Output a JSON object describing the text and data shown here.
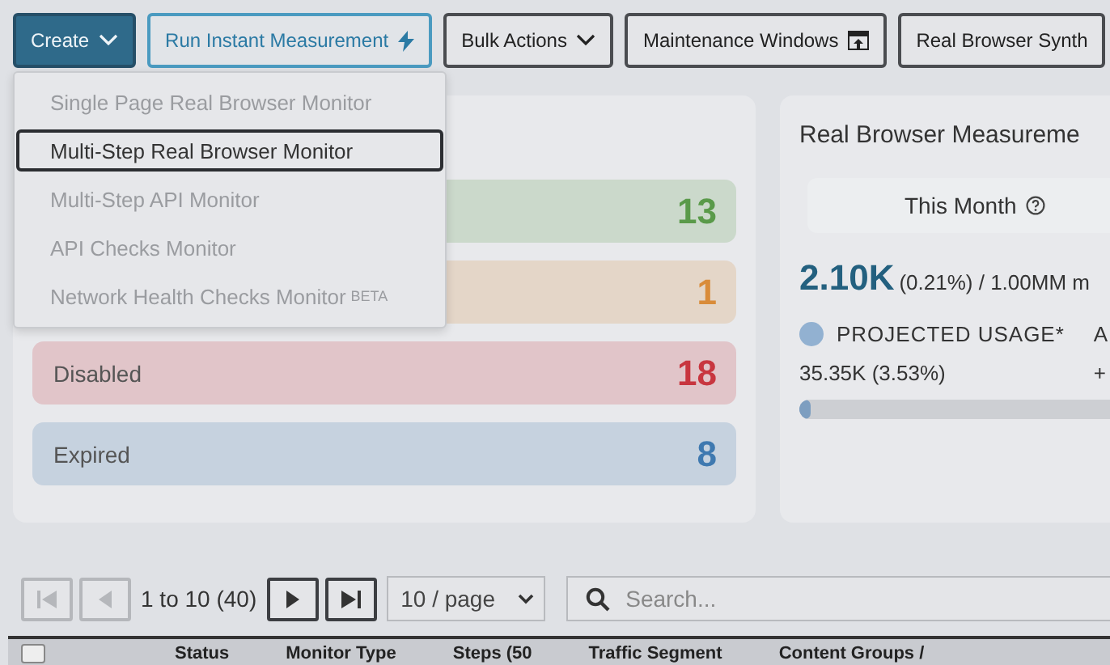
{
  "toolbar": {
    "buttons": [
      {
        "label": "Create",
        "kind": "primary"
      },
      {
        "label": "Run Instant Measurement",
        "kind": "accent"
      },
      {
        "label": "Bulk Actions",
        "kind": "dropdown"
      },
      {
        "label": "Maintenance Windows",
        "kind": "window"
      },
      {
        "label": "Real Browser Synth",
        "kind": "plain"
      }
    ]
  },
  "create_menu": {
    "items": [
      {
        "label": "Single Page Real Browser Monitor",
        "selected": false
      },
      {
        "label": "Multi-Step Real Browser Monitor",
        "selected": true
      },
      {
        "label": "Multi-Step API Monitor",
        "selected": false
      },
      {
        "label": "API Checks Monitor",
        "selected": false
      },
      {
        "label": "Network Health Checks Monitor",
        "badge": "BETA",
        "selected": false
      }
    ]
  },
  "status_card": {
    "rows": [
      {
        "count": "13",
        "color": "#5a9a4a"
      },
      {
        "count": "1",
        "color": "#d98c3a"
      },
      {
        "label": "Disabled",
        "count": "18",
        "color": "#c8363f"
      },
      {
        "label": "Expired",
        "count": "8",
        "color": "#3f79b0"
      }
    ]
  },
  "usage_card": {
    "title": "Real Browser Measureme",
    "tab": "This Month",
    "total": "2.10K",
    "total_detail": "(0.21%) / 1.00MM m",
    "legend": [
      {
        "label": "PROJECTED USAGE*",
        "value": "35.35K (3.53%)"
      },
      {
        "label": "A",
        "value": "+"
      }
    ],
    "level": 0.0353
  },
  "pagination": {
    "range": "1 to 10 (40)",
    "first_disabled": true,
    "prev_disabled": true,
    "page_size": "10 / page",
    "search_placeholder": "Search..."
  },
  "table": {
    "select_all_checked": false,
    "columns": [
      "Status",
      "Monitor Type",
      "Steps (50",
      "Traffic Segment",
      "Content Groups / "
    ]
  }
}
